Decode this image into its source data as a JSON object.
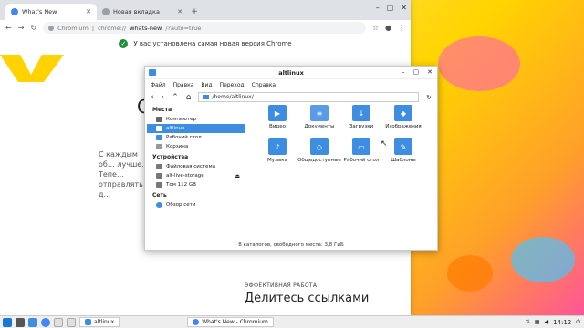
{
  "colors": {
    "accent": "#3d8ee0",
    "green": "#1e8e3e",
    "chevron": "#ffd200"
  },
  "browser": {
    "tabs": [
      {
        "label": "What's New",
        "icon": "chromium-icon"
      },
      {
        "label": "Новая вкладка",
        "icon": "globe-icon"
      }
    ],
    "omnibox": {
      "site": "Chromium",
      "url_prefix": "chrome://",
      "url_host": "whats-new",
      "url_rest": "/?auto=true"
    },
    "notice": "У вас установлена самая новая версия Chrome",
    "page": {
      "big_text": "C",
      "paragraph": "С каждым об… лучше. Тепе… отправлять д…",
      "section_label": "ЭФФЕКТИВНАЯ РАБОТА",
      "section_title": "Делитесь ссылками"
    }
  },
  "filemanager": {
    "title": "altlinux",
    "menu": [
      "Файл",
      "Правка",
      "Вид",
      "Переход",
      "Справка"
    ],
    "path": "/home/altlinux/",
    "sidebar": {
      "places_header": "Места",
      "places": [
        "Компьютер",
        "altlinux",
        "Рабочий стол",
        "Корзина"
      ],
      "devices_header": "Устройства",
      "devices": [
        "Файловая система",
        "alt-live-storage",
        "Том 112 GB"
      ],
      "network_header": "Сеть",
      "network": [
        "Обзор сети"
      ]
    },
    "folders": [
      {
        "label": "Видео",
        "icon": "video-folder-icon"
      },
      {
        "label": "Документы",
        "icon": "documents-folder-icon"
      },
      {
        "label": "Загрузки",
        "icon": "downloads-folder-icon"
      },
      {
        "label": "Изображения",
        "icon": "pictures-folder-icon"
      },
      {
        "label": "Музыка",
        "icon": "music-folder-icon"
      },
      {
        "label": "Общедоступные",
        "icon": "public-folder-icon"
      },
      {
        "label": "Рабочий стол",
        "icon": "desktop-folder-icon"
      },
      {
        "label": "Шаблоны",
        "icon": "templates-folder-icon"
      }
    ],
    "status": "8 каталогов, свободного места: 3,8 ГиБ"
  },
  "taskbar": {
    "tasks": [
      "altlinux",
      "What's New - Chromium"
    ],
    "clock": "14:12"
  }
}
